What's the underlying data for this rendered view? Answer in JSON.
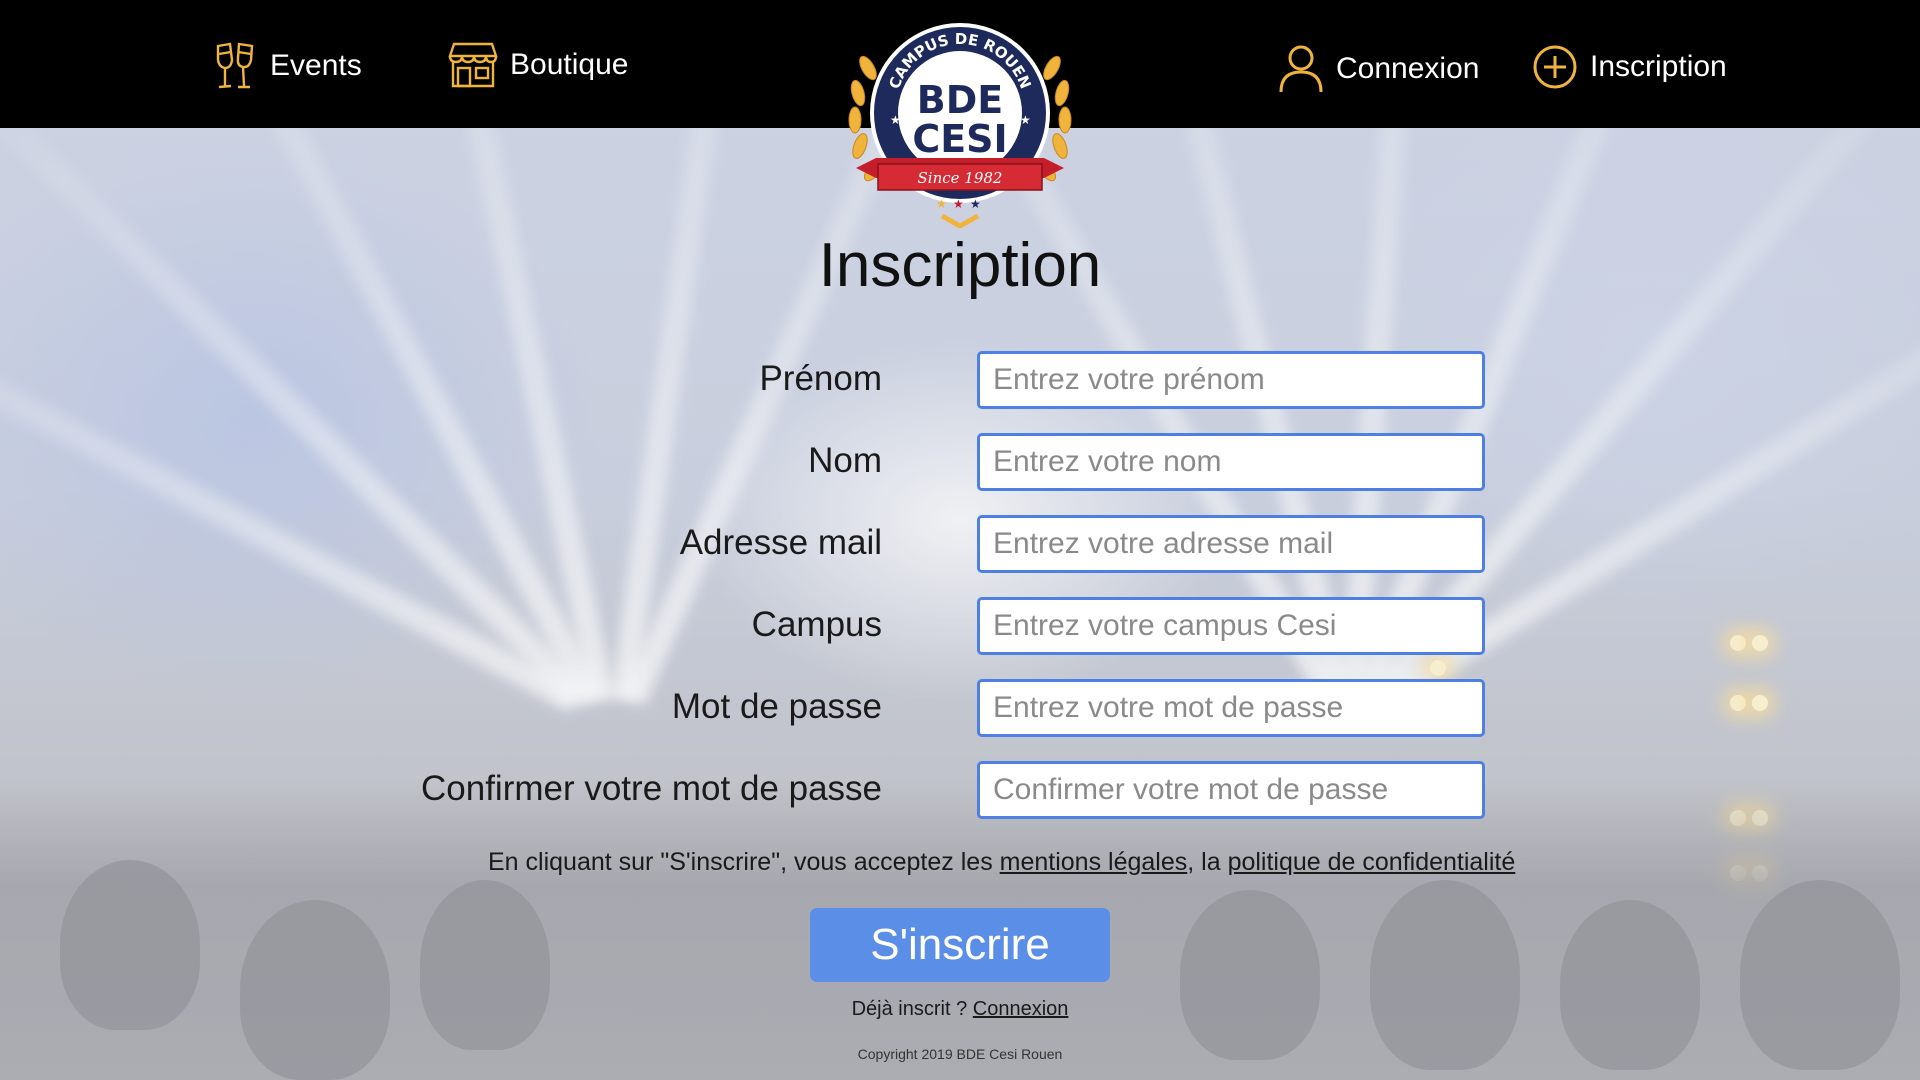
{
  "nav": {
    "events_label": "Events",
    "boutique_label": "Boutique",
    "connexion_label": "Connexion",
    "inscription_label": "Inscription"
  },
  "logo": {
    "arc_text": "CAMPUS DE ROUEN",
    "line1": "BDE",
    "line2": "CESI",
    "ribbon": "Since 1982"
  },
  "form": {
    "title": "Inscription",
    "fields": [
      {
        "label": "Prénom",
        "value": "",
        "placeholder": "Entrez votre prénom"
      },
      {
        "label": "Nom",
        "value": "",
        "placeholder": "Entrez votre nom"
      },
      {
        "label": "Adresse mail",
        "value": "",
        "placeholder": "Entrez votre adresse mail"
      },
      {
        "label": "Campus",
        "value": "",
        "placeholder": "Entrez votre campus Cesi"
      },
      {
        "label": "Mot de passe",
        "value": "",
        "placeholder": "Entrez votre mot de passe"
      },
      {
        "label": "Confirmer votre mot de passe",
        "value": "",
        "placeholder": "Confirmer votre mot de passe"
      }
    ],
    "terms_prefix": "En cliquant sur \"S'inscrire\", vous acceptez les ",
    "terms_link1": "mentions légales",
    "terms_middle": ", la ",
    "terms_link2": "politique de confidentialité",
    "submit_label": "S'inscrire",
    "already_text": "Déjà inscrit ? ",
    "already_link": "Connexion"
  },
  "footer": {
    "copyright": "Copyright 2019 BDE Cesi Rouen"
  },
  "colors": {
    "accent_gold": "#f0b43c",
    "input_border": "#4f7fe0",
    "button": "#5b8ee6",
    "topbar": "#000000"
  },
  "icons": {
    "events": "champagne-glasses-icon",
    "boutique": "shop-icon",
    "connexion": "user-icon",
    "inscription": "plus-circle-icon"
  }
}
